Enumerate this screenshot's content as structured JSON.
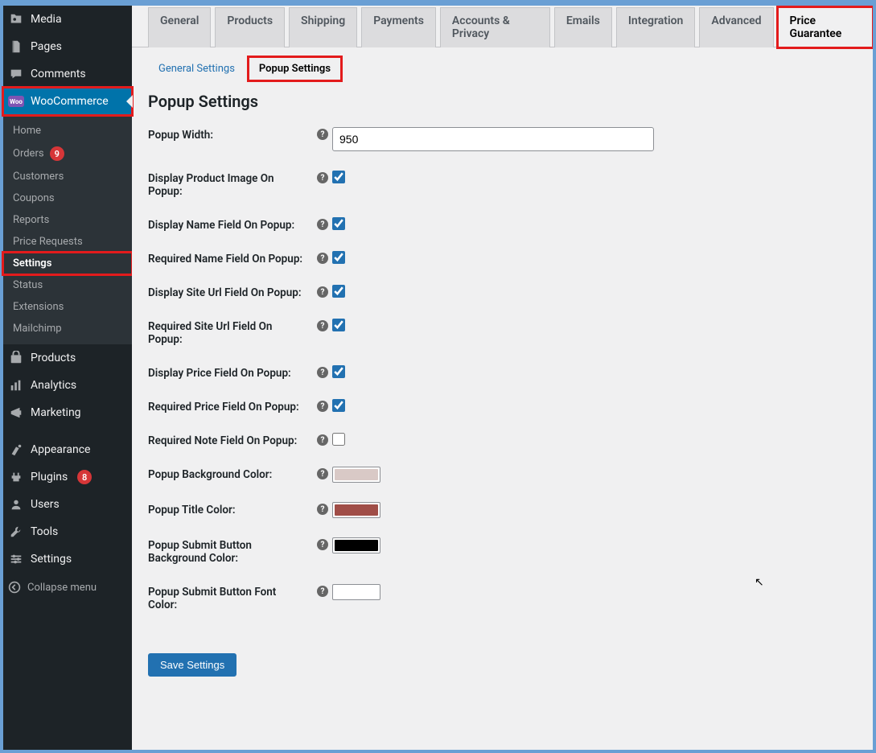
{
  "sidebar": {
    "top_items": [
      {
        "label": "Media"
      },
      {
        "label": "Pages"
      },
      {
        "label": "Comments"
      }
    ],
    "woo_label": "WooCommerce",
    "woo_sub": [
      {
        "label": "Home"
      },
      {
        "label": "Orders",
        "badge": "9"
      },
      {
        "label": "Customers"
      },
      {
        "label": "Coupons"
      },
      {
        "label": "Reports"
      },
      {
        "label": "Price Requests"
      },
      {
        "label": "Settings",
        "current": true
      },
      {
        "label": "Status"
      },
      {
        "label": "Extensions"
      },
      {
        "label": "Mailchimp"
      }
    ],
    "mid_items": [
      {
        "label": "Products"
      },
      {
        "label": "Analytics"
      },
      {
        "label": "Marketing"
      }
    ],
    "bottom_items": [
      {
        "label": "Appearance"
      },
      {
        "label": "Plugins",
        "badge": "8"
      },
      {
        "label": "Users"
      },
      {
        "label": "Tools"
      },
      {
        "label": "Settings"
      }
    ],
    "collapse": "Collapse menu"
  },
  "tabs": {
    "items": [
      "General",
      "Products",
      "Shipping",
      "Payments",
      "Accounts & Privacy",
      "Emails",
      "Integration",
      "Advanced",
      "Price Guarantee"
    ],
    "active_index": 8
  },
  "subtabs": {
    "general": "General Settings",
    "popup": "Popup Settings"
  },
  "heading": "Popup Settings",
  "form": {
    "popup_width": {
      "label": "Popup Width:",
      "value": "950"
    },
    "display_image": {
      "label": "Display Product Image On Popup:",
      "checked": true
    },
    "display_name": {
      "label": "Display Name Field On Popup:",
      "checked": true
    },
    "required_name": {
      "label": "Required Name Field On Popup:",
      "checked": true
    },
    "display_site": {
      "label": "Display Site Url Field On Popup:",
      "checked": true
    },
    "required_site": {
      "label": "Required Site Url Field On Popup:",
      "checked": true
    },
    "display_price": {
      "label": "Display Price Field On Popup:",
      "checked": true
    },
    "required_price": {
      "label": "Required Price Field On Popup:",
      "checked": true
    },
    "required_note": {
      "label": "Required Note Field On Popup:",
      "checked": false
    },
    "bg_color": {
      "label": "Popup Background Color:",
      "value": "#d9c9c6"
    },
    "title_color": {
      "label": "Popup Title Color:",
      "value": "#a04d47"
    },
    "btn_bg": {
      "label": "Popup Submit Button Background Color:",
      "value": "#000000"
    },
    "btn_font": {
      "label": "Popup Submit Button Font Color:",
      "value": "#ffffff"
    }
  },
  "save_button": "Save Settings"
}
